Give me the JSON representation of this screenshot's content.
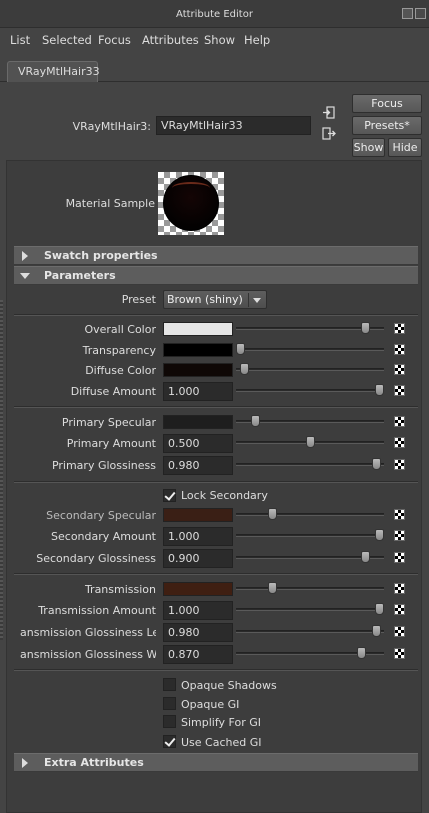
{
  "window": {
    "title": "Attribute Editor"
  },
  "menu": [
    "List",
    "Selected",
    "Focus",
    "Attributes",
    "Show",
    "Help"
  ],
  "tab": {
    "label": "VRayMtlHair33"
  },
  "node": {
    "label": "VRayMtlHair3:",
    "value": "VRayMtlHair33"
  },
  "buttons": {
    "focus": "Focus",
    "presets": "Presets*",
    "show": "Show",
    "hide": "Hide"
  },
  "material_sample_label": "Material Sample",
  "sections": {
    "swatch": "Swatch properties",
    "parameters": "Parameters",
    "extra": "Extra Attributes"
  },
  "preset": {
    "label": "Preset",
    "value": "Brown (shiny)"
  },
  "attributes": {
    "overall_color": {
      "label": "Overall Color",
      "color": "#e6e6e6",
      "slider": 0.9
    },
    "transparency": {
      "label": "Transparency",
      "color": "#000000",
      "slider": 0.0
    },
    "diffuse_color": {
      "label": "Diffuse Color",
      "color": "#0f0806",
      "slider": 0.03
    },
    "diffuse_amount": {
      "label": "Diffuse Amount",
      "value": "1.000",
      "slider": 1.0
    },
    "primary_specular": {
      "label": "Primary Specular",
      "color": "#1e1e1e",
      "slider": 0.11
    },
    "primary_amount": {
      "label": "Primary Amount",
      "value": "0.500",
      "slider": 0.5
    },
    "primary_glossiness": {
      "label": "Primary Glossiness",
      "value": "0.980",
      "slider": 0.98
    },
    "lock_secondary": {
      "label": "Lock Secondary",
      "checked": true
    },
    "secondary_specular": {
      "label": "Secondary Specular",
      "color": "#3a1f15",
      "slider": 0.23
    },
    "secondary_amount": {
      "label": "Secondary Amount",
      "value": "1.000",
      "slider": 1.0
    },
    "secondary_glossiness": {
      "label": "Secondary Glossiness",
      "value": "0.900",
      "slider": 0.9
    },
    "transmission": {
      "label": "Transmission",
      "color": "#3f1f12",
      "slider": 0.23
    },
    "transmission_amount": {
      "label": "Transmission Amount",
      "value": "1.000",
      "slider": 1.0
    },
    "transmission_gloss_length": {
      "label": "ansmission Glossiness Length",
      "value": "0.980",
      "slider": 0.98
    },
    "transmission_gloss_width": {
      "label": "ansmission Glossiness Width",
      "value": "0.870",
      "slider": 0.87
    }
  },
  "checkboxes": [
    {
      "label": "Opaque Shadows",
      "checked": false
    },
    {
      "label": "Opaque GI",
      "checked": false
    },
    {
      "label": "Simplify For GI",
      "checked": false
    },
    {
      "label": "Use Cached GI",
      "checked": true
    }
  ]
}
